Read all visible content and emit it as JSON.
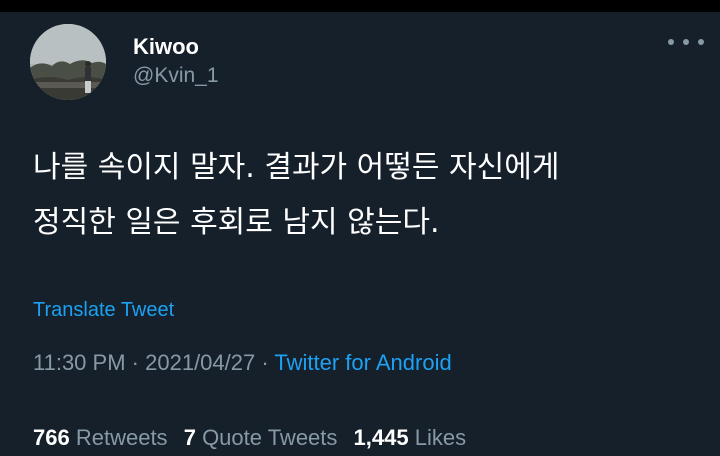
{
  "user": {
    "display_name": "Kiwoo",
    "handle": "@Kvin_1"
  },
  "tweet": {
    "lines": [
      "나를 속이지 말자. 결과가 어떻든 자신에게",
      "정직한 일은 후회로 남지 않는다."
    ],
    "translate_label": "Translate Tweet",
    "time": "11:30 PM",
    "separator": "·",
    "date": "2021/04/27",
    "source": "Twitter for Android"
  },
  "stats": {
    "retweets_count": "766",
    "retweets_label": "Retweets",
    "quotes_count": "7",
    "quotes_label": "Quote Tweets",
    "likes_count": "1,445",
    "likes_label": "Likes"
  },
  "icons": {
    "more": "more-horizontal-icon",
    "avatar": "profile-photo"
  },
  "colors": {
    "background": "#15202b",
    "accent": "#1da1f2",
    "secondary_text": "#8899a6",
    "primary_text": "#ffffff"
  }
}
